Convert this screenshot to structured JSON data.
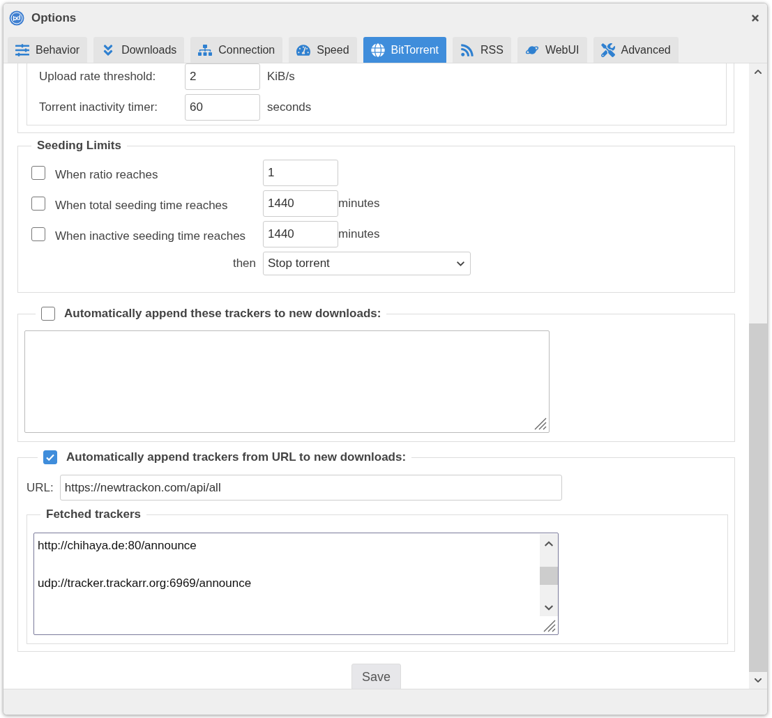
{
  "window": {
    "title": "Options"
  },
  "tabs": [
    {
      "label": "Behavior",
      "selected": false
    },
    {
      "label": "Downloads",
      "selected": false
    },
    {
      "label": "Connection",
      "selected": false
    },
    {
      "label": "Speed",
      "selected": false
    },
    {
      "label": "BitTorrent",
      "selected": true
    },
    {
      "label": "RSS",
      "selected": false
    },
    {
      "label": "WebUI",
      "selected": false
    },
    {
      "label": "Advanced",
      "selected": false
    }
  ],
  "transfer_rows": [
    {
      "label": "Upload rate threshold:",
      "value": "2",
      "unit": "KiB/s"
    },
    {
      "label": "Torrent inactivity timer:",
      "value": "60",
      "unit": "seconds"
    }
  ],
  "seeding_limits": {
    "legend": "Seeding Limits",
    "rows": [
      {
        "label": "When ratio reaches",
        "checked": false,
        "value": "1"
      },
      {
        "label": "When total seeding time reaches",
        "checked": false,
        "value": "1440",
        "unit": "minutes"
      },
      {
        "label": "When inactive seeding time reaches",
        "checked": false,
        "value": "1440",
        "unit": "minutes"
      }
    ],
    "then_label": "then",
    "action": "Stop torrent"
  },
  "append_trackers": {
    "label": "Automatically append these trackers to new downloads:",
    "checked": false
  },
  "append_from_url": {
    "label": "Automatically append trackers from URL to new downloads:",
    "checked": true,
    "url_label": "URL:",
    "url": "https://newtrackon.com/api/all",
    "fetched_legend": "Fetched trackers",
    "fetched": [
      "http://chihaya.de:80/announce",
      "udp://tracker.trackarr.org:6969/announce"
    ]
  },
  "save_button": "Save"
}
